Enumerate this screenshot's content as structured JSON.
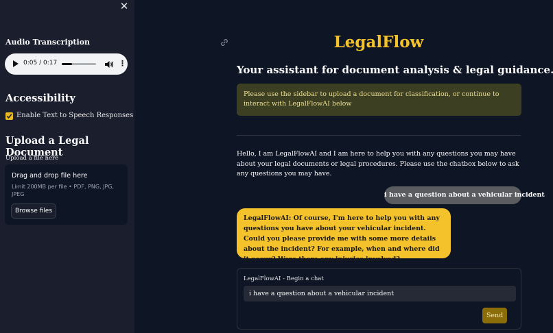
{
  "sidebar": {
    "audio_heading": "Audio Transcription",
    "audio": {
      "time": "0:05 / 0:17",
      "progress_fraction": 0.29
    },
    "accessibility_heading": "Accessibility",
    "tts_checkbox": {
      "label": "Enable Text to Speech Responses",
      "checked": true
    },
    "upload_heading": "Upload a Legal Document",
    "upload_label": "Upload a file here",
    "dropzone": {
      "title": "Drag and drop file here",
      "limit": "Limit 200MB per file • PDF, PNG, JPG, JPEG",
      "browse_label": "Browse files"
    }
  },
  "main": {
    "title": "LegalFlow",
    "subtitle": "Your assistant for document analysis & legal guidance.",
    "info_message": "Please use the sidebar to upload a document for classification, or continue to interact with LegalFlowAI below",
    "intro": "Hello, I am LegalFlowAI and I am here to help you with any questions you may have about your legal documents or legal procedures. Please use the chatbox below to ask any questions you may have.",
    "messages": [
      {
        "role": "user",
        "text": "i have a question about a vehicular incident"
      },
      {
        "role": "assistant",
        "text": "LegalFlowAI: Of course, I'm here to help you with any questions you have about your vehicular incident. Could you please provide me with some more details about the incident? For example, when and where did it occur? Were there any injuries involved?"
      }
    ],
    "chat_form": {
      "label": "LegalFlowAI - Begin a chat",
      "input_value": "i have a question about a vehicular incident",
      "send_label": "Send"
    }
  },
  "colors": {
    "accent": "#f4c22b",
    "sidebar_bg": "#1a1e2d",
    "main_bg": "#0e1525",
    "info_bg": "#3d3f22",
    "send_bg": "#8a6c09"
  },
  "icons": [
    "close-icon",
    "play-icon",
    "volume-icon",
    "more-options-icon",
    "checkmark-icon",
    "link-icon"
  ]
}
